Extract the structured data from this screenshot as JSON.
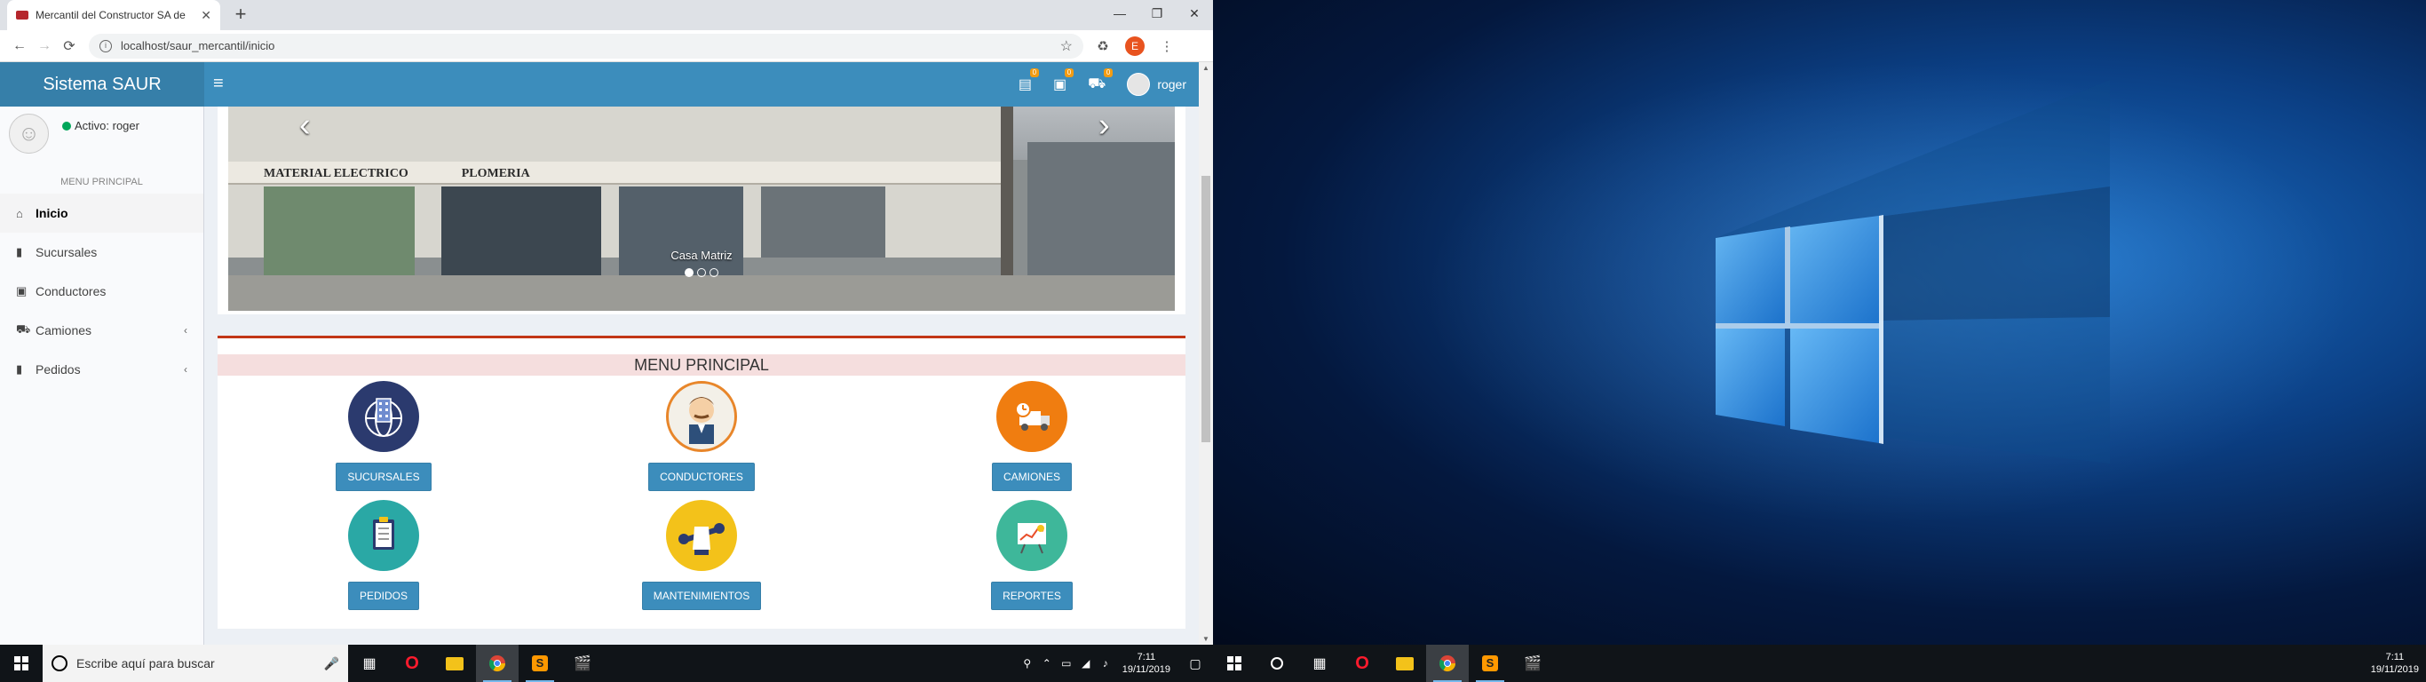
{
  "browser": {
    "tab_title": "Mercantil del Constructor SA de",
    "tab_close": "✕",
    "new_tab": "+",
    "url": "localhost/saur_mercantil/inicio",
    "profile_initial": "E",
    "window_controls": [
      "—",
      "❐",
      "✕"
    ]
  },
  "app": {
    "logo": "Sistema SAUR",
    "hamburger": "≡",
    "user": "roger",
    "notifications": [
      {
        "icon": "document-icon",
        "count": "0"
      },
      {
        "icon": "id-card-icon",
        "count": "0"
      },
      {
        "icon": "car-icon",
        "count": "0"
      }
    ]
  },
  "sidebar": {
    "status": "Activo: roger",
    "header": "MENU PRINCIPAL",
    "items": [
      {
        "label": "Inicio",
        "icon": "home-icon",
        "active": true
      },
      {
        "label": "Sucursales",
        "icon": "book-icon"
      },
      {
        "label": "Conductores",
        "icon": "id-card-icon"
      },
      {
        "label": "Camiones",
        "icon": "truck-icon",
        "caret": "‹"
      },
      {
        "label": "Pedidos",
        "icon": "book-icon",
        "caret": "‹"
      }
    ]
  },
  "carousel": {
    "caption": "Casa Matriz",
    "signs": [
      "MATERIAL ELECTRICO",
      "PLOMERIA"
    ],
    "slides": 3,
    "active_slide": 0,
    "prev": "‹",
    "next": "›"
  },
  "menu": {
    "title": "MENU PRINCIPAL",
    "items": [
      {
        "label": "SUCURSALES",
        "icon": "building-globe-icon",
        "color": "#2b3a6e"
      },
      {
        "label": "CONDUCTORES",
        "icon": "driver-icon",
        "color": "#e8862a"
      },
      {
        "label": "CAMIONES",
        "icon": "truck-clock-icon",
        "color": "#f07d10"
      },
      {
        "label": "PEDIDOS",
        "icon": "clipboard-icon",
        "color": "#2aa8a5"
      },
      {
        "label": "MANTENIMIENTOS",
        "icon": "wrench-hand-icon",
        "color": "#f3c21a"
      },
      {
        "label": "REPORTES",
        "icon": "chart-board-icon",
        "color": "#3eb79a"
      }
    ]
  },
  "taskbar": {
    "search_placeholder": "Escribe aquí para buscar",
    "time": "7:11",
    "date": "19/11/2019"
  }
}
